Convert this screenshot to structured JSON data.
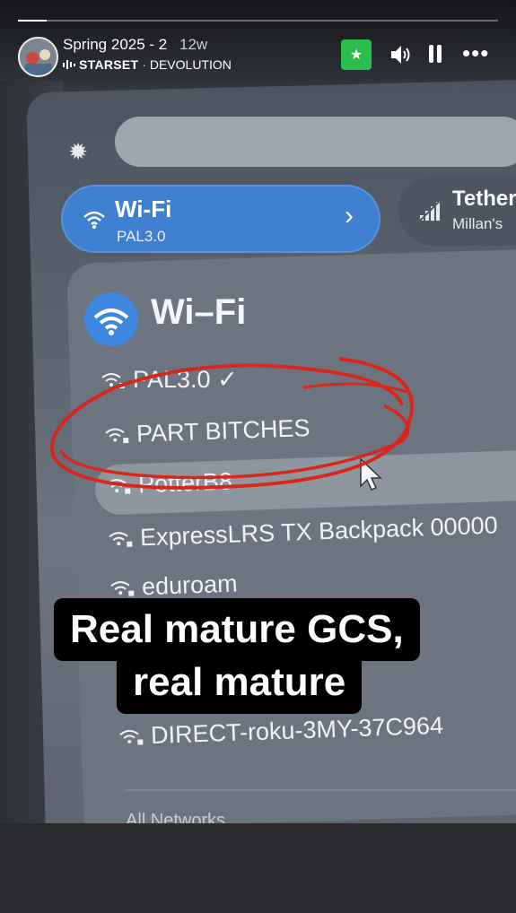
{
  "story": {
    "title": "Spring 2025 - 2",
    "age": "12w",
    "music_artist": "STARSET",
    "music_separator": " · ",
    "music_track": "DEVOLUTION",
    "progress": 0.06
  },
  "controls": {
    "favorite_icon": "star-icon",
    "sound_icon": "speaker-icon",
    "pause_icon": "pause-icon",
    "more_label": "•••"
  },
  "photo": {
    "quick_tile": {
      "title": "Wi-Fi",
      "subtitle": "PAL3.0",
      "chevron": "›"
    },
    "tether_tile": {
      "title": "Tether",
      "subtitle": "Millan's"
    },
    "panel_title": "Wi–Fi",
    "networks": [
      {
        "name": "PAL3.0",
        "check": "✓"
      },
      {
        "name": "PART BITCHES"
      },
      {
        "name": "PotterB8"
      },
      {
        "name": "ExpressLRS TX Backpack 00000"
      },
      {
        "name": "eduroam"
      },
      {
        "name": "DIRECT-roku-3MY-37C964"
      }
    ],
    "footer_text": "All Networks"
  },
  "caption": {
    "line1": "Real mature GCS,",
    "line2": "real mature"
  },
  "colors": {
    "accent_wifi": "#3f7fd0",
    "favorite_green": "#2bbd4f",
    "annotation_red": "#d9261c",
    "caption_bg": "#000000"
  }
}
